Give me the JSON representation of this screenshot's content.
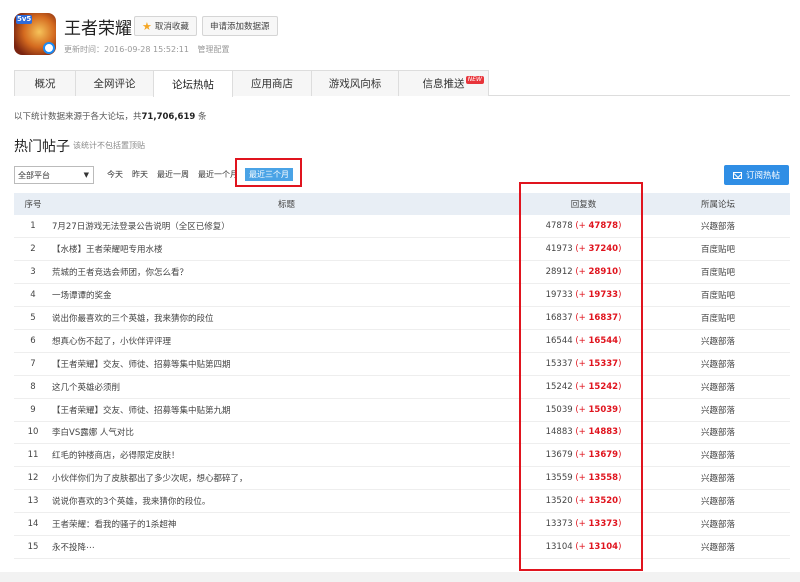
{
  "app": {
    "badge": "5v5",
    "title": "王者荣耀",
    "fav_button": "取消收藏",
    "apply_button": "申请添加数据源",
    "updated": "更新时间：2016-09-28 15:52:11",
    "manage": "管理配置"
  },
  "tabs": [
    {
      "label": "概况"
    },
    {
      "label": "全网评论"
    },
    {
      "label": "论坛热帖"
    },
    {
      "label": "应用商店"
    },
    {
      "label": "游戏风向标"
    },
    {
      "label": "信息推送",
      "badge": "NEW"
    }
  ],
  "active_tab": "论坛热帖",
  "data_source": {
    "prefix": "以下统计数据来源于各大论坛，共",
    "count": "71,706,619",
    "suffix": "条"
  },
  "section": {
    "title": "热门帖子",
    "note": "该统计不包括置顶贴"
  },
  "filters": {
    "platform": "全部平台",
    "time": [
      "今天",
      "昨天",
      "最近一周",
      "最近一个月",
      "最近三个月"
    ],
    "active_time": "最近三个月"
  },
  "subscribe": "订阅热帖",
  "table": {
    "headers": {
      "index": "序号",
      "title": "标题",
      "replies": "回复数",
      "forum": "所属论坛"
    },
    "rows": [
      {
        "idx": "1",
        "title": "7月27日游戏无法登录公告说明（全区已修复）",
        "total": "47878",
        "delta": "47878",
        "forum": "兴趣部落"
      },
      {
        "idx": "2",
        "title": "【水楼】王者荣耀吧专用水楼",
        "total": "41973",
        "delta": "37240",
        "forum": "百度贴吧"
      },
      {
        "idx": "3",
        "title": "荒城的王者竞选会师团，你怎么看？",
        "total": "28912",
        "delta": "28910",
        "forum": "百度贴吧"
      },
      {
        "idx": "4",
        "title": "一场谭谭的奖金",
        "total": "19733",
        "delta": "19733",
        "forum": "百度贴吧"
      },
      {
        "idx": "5",
        "title": "说出你最喜欢的三个英雄，我来猜你的段位",
        "total": "16837",
        "delta": "16837",
        "forum": "百度贴吧"
      },
      {
        "idx": "6",
        "title": "想真心伤不起了，小伙伴评评理",
        "total": "16544",
        "delta": "16544",
        "forum": "兴趣部落"
      },
      {
        "idx": "7",
        "title": "【王者荣耀】交友、师徒、招募等集中贴第四期",
        "total": "15337",
        "delta": "15337",
        "forum": "兴趣部落"
      },
      {
        "idx": "8",
        "title": "这几个英雄必须削",
        "total": "15242",
        "delta": "15242",
        "forum": "兴趣部落"
      },
      {
        "idx": "9",
        "title": "【王者荣耀】交友、师徒、招募等集中贴第九期",
        "total": "15039",
        "delta": "15039",
        "forum": "兴趣部落"
      },
      {
        "idx": "10",
        "title": "李白VS露娜 人气对比",
        "total": "14883",
        "delta": "14883",
        "forum": "兴趣部落"
      },
      {
        "idx": "11",
        "title": "红毛的钟楼商店，必得限定皮肤！",
        "total": "13679",
        "delta": "13679",
        "forum": "兴趣部落"
      },
      {
        "idx": "12",
        "title": "小伙伴你们为了皮肤都出了多少次呢，想心都碎了，",
        "total": "13559",
        "delta": "13558",
        "forum": "兴趣部落"
      },
      {
        "idx": "13",
        "title": "说说你喜欢的3个英雄，我来猜你的段位。",
        "total": "13520",
        "delta": "13520",
        "forum": "兴趣部落"
      },
      {
        "idx": "14",
        "title": "王者荣耀：看我的骚子的1杀超神",
        "total": "13373",
        "delta": "13373",
        "forum": "兴趣部落"
      },
      {
        "idx": "15",
        "title": "永不投降⋯",
        "total": "13104",
        "delta": "13104",
        "forum": "兴趣部落"
      }
    ]
  }
}
